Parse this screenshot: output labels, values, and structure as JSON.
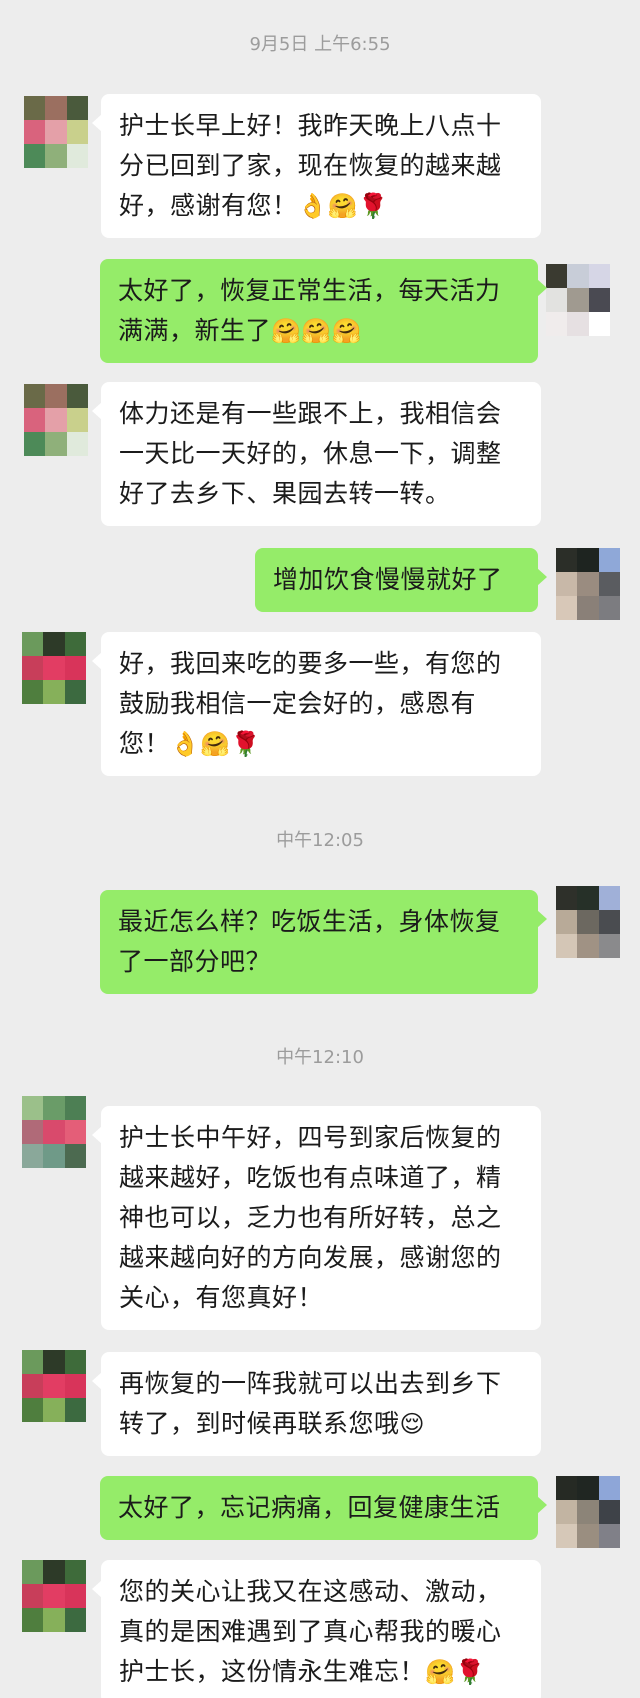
{
  "timestamps": [
    "9月5日 上午6:55",
    "中午12:05",
    "中午12:10"
  ],
  "messages": [
    {
      "side": "in",
      "text": "护士长早上好！我昨天晚上八点十分已回到了家，现在恢复的越来越好，感谢有您！",
      "emojis": "👌🤗🌹"
    },
    {
      "side": "out",
      "text": "太好了，恢复正常生活，每天活力满满，新生了",
      "emojis": "🤗🤗🤗"
    },
    {
      "side": "in",
      "text": "体力还是有一些跟不上，我相信会一天比一天好的，休息一下，调整好了去乡下、果园去转一转。",
      "emojis": ""
    },
    {
      "side": "out",
      "text": "增加饮食慢慢就好了",
      "emojis": ""
    },
    {
      "side": "in",
      "text": "好，我回来吃的要多一些，有您的鼓励我相信一定会好的，感恩有您！",
      "emojis": "👌🤗🌹"
    },
    {
      "side": "out",
      "text": "最近怎么样？吃饭生活，身体恢复了一部分吧？",
      "emojis": ""
    },
    {
      "side": "in",
      "text": "护士长中午好，四号到家后恢复的越来越好，吃饭也有点味道了，精神也可以，乏力也有所好转，总之越来越向好的方向发展，感谢您的关心，有您真好！",
      "emojis": ""
    },
    {
      "side": "in",
      "text": "再恢复的一阵我就可以出去到乡下转了，到时候再联系您哦",
      "emojis": "😌"
    },
    {
      "side": "out",
      "text": "太好了，忘记病痛，回复健康生活",
      "emojis": ""
    },
    {
      "side": "in",
      "text": "您的关心让我又在这感动、激动，真的是困难遇到了真心帮我的暖心护士长，这份情永生难忘！",
      "emojis": "🤗🌹"
    }
  ],
  "colors": {
    "background": "#ededed",
    "incoming_bubble": "#ffffff",
    "outgoing_bubble": "#95ec69",
    "timestamp_text": "#9c9c9c"
  },
  "avatars": {
    "contact_a": [
      "#6a6a48",
      "#9b6f60",
      "#4a5a3c",
      "#d9637d",
      "#e4a0a8",
      "#c9d08c",
      "#4d8a58",
      "#8fb07a",
      "#e0eadc"
    ],
    "contact_b": [
      "#6b9a5c",
      "#2d3a28",
      "#3e6b3a",
      "#c83e5a",
      "#e23d63",
      "#d8345a",
      "#4f7e3e",
      "#86b05a",
      "#3c6a40"
    ],
    "contact_c": [
      "#9bc08a",
      "#6a9c68",
      "#4d7f54",
      "#b06a78",
      "#d94a6c",
      "#e45e78",
      "#8aa89a",
      "#6f9a88",
      "#4c6a50"
    ],
    "self": [
      "#3a3a30",
      "#c8cdd8",
      "#d6d6e6",
      "#e2e2e0",
      "#a09a90",
      "#4a4a52",
      "#f0ecec",
      "#e6e0e2",
      "#ffffff"
    ],
    "self_b": [
      "#2b2e28",
      "#1e2420",
      "#8fa8d8",
      "#c8b8a8",
      "#9a8c80",
      "#5a5c60",
      "#d8c8b8",
      "#8a8078",
      "#7c7c80"
    ],
    "self_c": [
      "#2e302a",
      "#263028",
      "#a0b0d8",
      "#b8aa98",
      "#6c6860",
      "#4a4c50",
      "#d4c6b6",
      "#a09284",
      "#8a8a8c"
    ],
    "self_d": [
      "#262a24",
      "#202622",
      "#8ea6d8",
      "#c2b4a2",
      "#8c8478",
      "#3e4248",
      "#d6c8b8",
      "#9a8e80",
      "#808088"
    ]
  }
}
